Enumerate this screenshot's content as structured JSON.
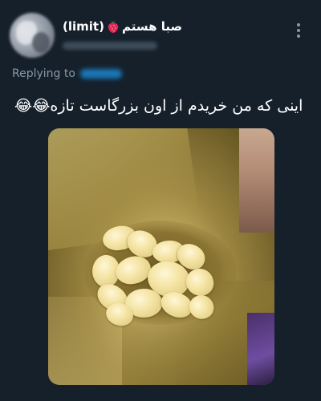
{
  "tweet": {
    "display_name": "(limit)",
    "display_name_prefix": "صبا هستم",
    "reply_label": "Replying to",
    "text": "اینی که من خریدم از اون بزرگاست تازه😂😂"
  },
  "icons": {
    "name_emoji": "strawberry-icon",
    "more": "more-vertical-icon"
  },
  "colors": {
    "background": "#15202b",
    "muted": "#8899a6",
    "link": "#1d9bf0"
  }
}
